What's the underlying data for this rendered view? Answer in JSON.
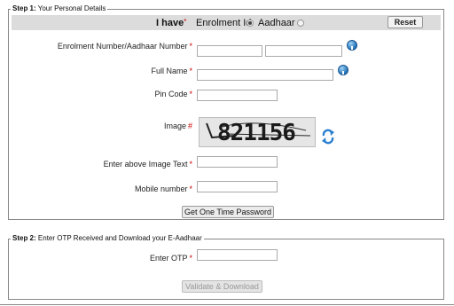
{
  "step1": {
    "legend_step": "Step 1:",
    "legend_text": "Your Personal Details",
    "i_have": "I have",
    "i_have_required": "*",
    "options": [
      {
        "label": "Enrolment Id",
        "selected": true
      },
      {
        "label": "Aadhaar",
        "selected": false
      }
    ],
    "reset_label": "Reset",
    "fields": {
      "enrolment_label": "Enrolment Number/Aadhaar Number",
      "full_name_label": "Full Name",
      "pin_code_label": "Pin Code",
      "image_label": "Image",
      "image_text_label": "Enter above Image Text",
      "mobile_label": "Mobile number"
    },
    "required_mark": "*",
    "image_mark": "#",
    "captcha_text": "821156",
    "get_otp_label": "Get One Time Password"
  },
  "step2": {
    "legend_step": "Step 2:",
    "legend_text": "Enter OTP Received and Download your E-Aadhaar",
    "otp_label": "Enter OTP",
    "validate_label": "Validate & Download"
  },
  "icons": {
    "info": "info-icon",
    "refresh": "refresh-icon"
  },
  "colors": {
    "required": "#cc0000",
    "header_bar": "#dcdcdc",
    "info_icon": "#1e6fb5",
    "refresh_icon": "#2a7fd0"
  }
}
